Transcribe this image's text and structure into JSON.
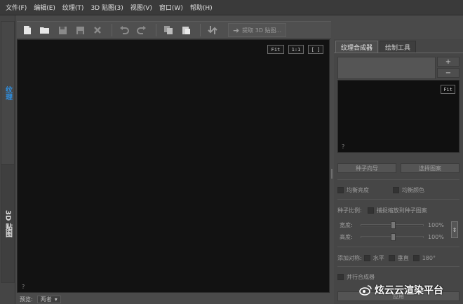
{
  "menu": [
    "文件(F)",
    "编辑(E)",
    "纹理(T)",
    "3D 贴图(3)",
    "视图(V)",
    "窗口(W)",
    "帮助(H)"
  ],
  "toolbar": {
    "icons": [
      "new-file-icon",
      "open-folder-icon",
      "save-icon",
      "save-as-icon",
      "close-icon",
      "undo-icon",
      "redo-icon",
      "copy-icon",
      "paste-icon",
      "convert-icon"
    ],
    "extract_label": "提取 3D 贴图..."
  },
  "left_tabs": {
    "top": "纹理",
    "bottom": "3D 贴图"
  },
  "viewport": {
    "fit": "Fit",
    "one_to_one": "1:1",
    "full": "[ ]",
    "help": "?"
  },
  "status": {
    "label": "预览:",
    "value": "两者"
  },
  "panel": {
    "tabs": [
      "纹理合成器",
      "绘制工具"
    ],
    "add": "+",
    "remove": "−",
    "preview_fit": "Fit",
    "preview_help": "?",
    "seed_wizard": "种子向导",
    "select_pattern": "选择图案",
    "equalize_brightness": "均衡亮度",
    "equalize_color": "均衡颜色",
    "seed_scale": "种子比例:",
    "capture_scale": "捕捉缩放到种子图案",
    "width_label": "宽度:",
    "width_value": "100%",
    "height_label": "高度:",
    "height_value": "100%",
    "add_symmetry": "添加对称:",
    "horizontal": "水平",
    "vertical": "垂直",
    "rot180": "180°",
    "parallel_synth": "并行合成器",
    "apply": "应用"
  },
  "sliders": {
    "width_pct": 0.5,
    "height_pct": 0.5
  },
  "watermark": "炫云云渲染平台",
  "colors": {
    "accent_tab": "#2f8fe0",
    "viewport_bg": "#121212",
    "ui_bg": "#4a4a4a"
  }
}
